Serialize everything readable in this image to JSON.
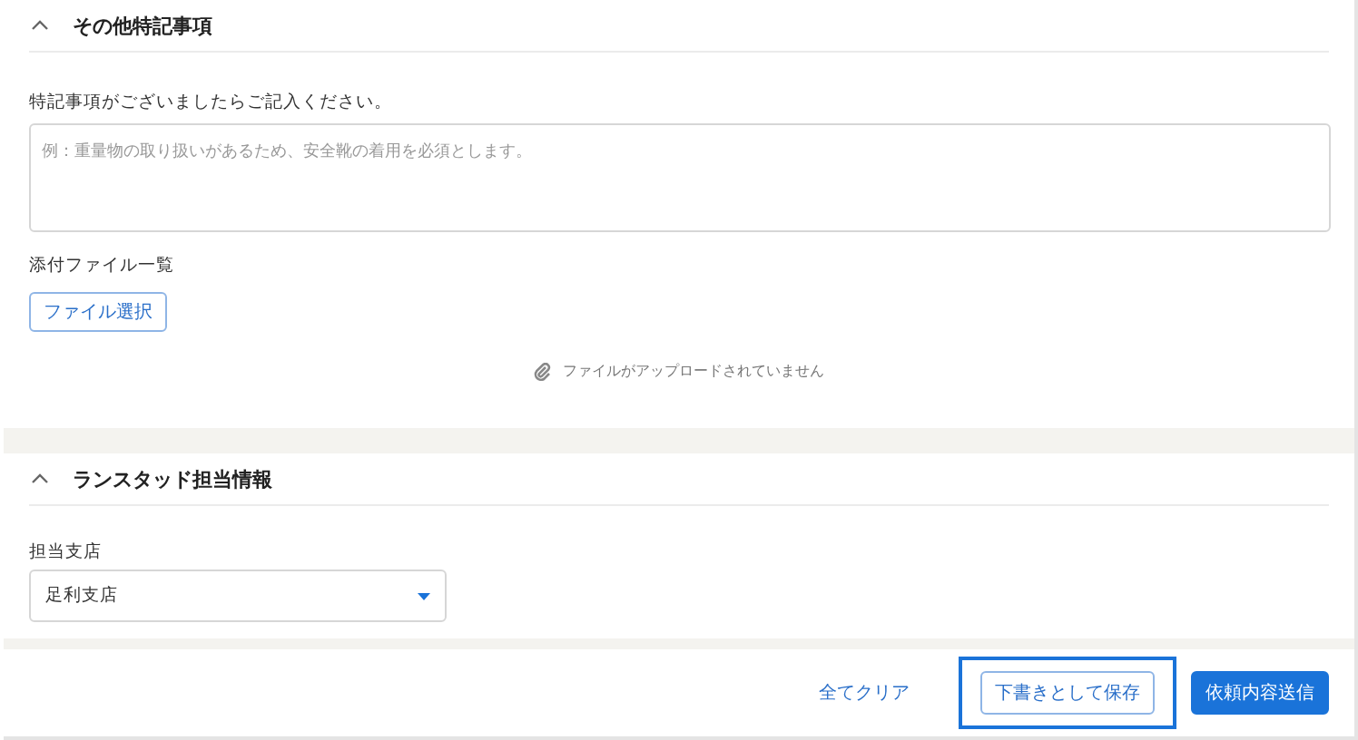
{
  "sections": [
    {
      "title": "その他特記事項",
      "expanded": true,
      "kind": "notes",
      "notes_label": "特記事項がございましたらご記入ください。",
      "notes_placeholder": "例：重量物の取り扱いがあるため、安全靴の着用を必須とします。",
      "attachments_label": "添付ファイル一覧",
      "file_button": "ファイル選択",
      "empty_message": "ファイルがアップロードされていません"
    },
    {
      "title": "ランスタッド担当情報",
      "expanded": true,
      "kind": "branch",
      "branch_label": "担当支店",
      "branch_value": "足利支店"
    }
  ],
  "footer": {
    "buttons": [
      {
        "label": "全てクリア",
        "kind": "link",
        "highlighted": false
      },
      {
        "label": "下書きとして保存",
        "kind": "outline",
        "highlighted": true
      },
      {
        "label": "依頼内容送信",
        "kind": "primary",
        "highlighted": false
      }
    ]
  }
}
